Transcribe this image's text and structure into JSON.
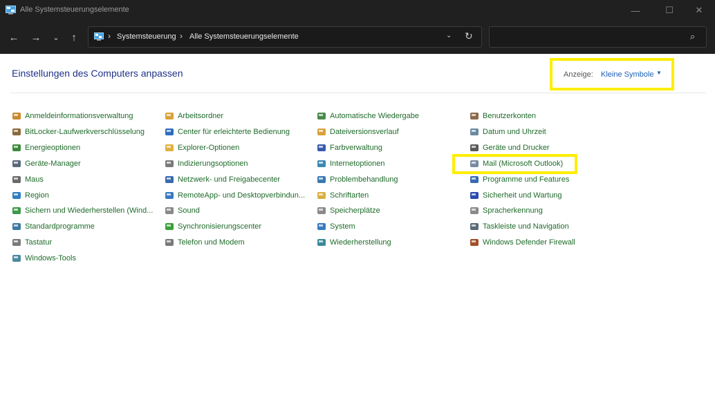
{
  "window": {
    "title": "Alle Systemsteuerungselemente",
    "minimize": "—",
    "maximize": "☐",
    "close": "✕"
  },
  "nav": {
    "back": "←",
    "forward": "→",
    "recent": "⌄",
    "up": "↑",
    "separator": "›",
    "breadcrumbs": [
      "Systemsteuerung",
      "Alle Systemsteuerungselemente"
    ],
    "dropdown": "⌄",
    "refresh": "↻",
    "search_placeholder": "",
    "search_glyph": "⌕"
  },
  "content": {
    "heading": "Einstellungen des Computers anpassen",
    "view_label": "Anzeige:",
    "view_value": "Kleine Symbole",
    "view_caret": "▼"
  },
  "items": {
    "col0": [
      {
        "label": "Anmeldeinformationsverwaltung",
        "icon": "vault-icon",
        "color": "#c98a2e"
      },
      {
        "label": "BitLocker-Laufwerkverschlüsselung",
        "icon": "bitlocker-icon",
        "color": "#8a6a3a"
      },
      {
        "label": "Energieoptionen",
        "icon": "power-icon",
        "color": "#3c8a3c"
      },
      {
        "label": "Geräte-Manager",
        "icon": "device-manager-icon",
        "color": "#5a6a7a"
      },
      {
        "label": "Maus",
        "icon": "mouse-icon",
        "color": "#6a6a6a"
      },
      {
        "label": "Region",
        "icon": "globe-icon",
        "color": "#2f7fbf"
      },
      {
        "label": "Sichern und Wiederherstellen (Wind...",
        "icon": "backup-icon",
        "color": "#3c9a4a"
      },
      {
        "label": "Standardprogramme",
        "icon": "default-programs-icon",
        "color": "#3c7aa0"
      },
      {
        "label": "Tastatur",
        "icon": "keyboard-icon",
        "color": "#7a7a7a"
      },
      {
        "label": "Windows-Tools",
        "icon": "windows-tools-icon",
        "color": "#4a8aa0"
      }
    ],
    "col1": [
      {
        "label": "Arbeitsordner",
        "icon": "work-folders-icon",
        "color": "#d9a23a"
      },
      {
        "label": "Center für erleichterte Bedienung",
        "icon": "accessibility-icon",
        "color": "#2f6fbf"
      },
      {
        "label": "Explorer-Optionen",
        "icon": "folder-options-icon",
        "color": "#e0b040"
      },
      {
        "label": "Indizierungsoptionen",
        "icon": "indexing-icon",
        "color": "#7a7a7a"
      },
      {
        "label": "Netzwerk- und Freigabecenter",
        "icon": "network-icon",
        "color": "#3a6ab0"
      },
      {
        "label": "RemoteApp- und Desktopverbindun...",
        "icon": "remoteapp-icon",
        "color": "#3a7ac0"
      },
      {
        "label": "Sound",
        "icon": "speaker-icon",
        "color": "#8a8a8a"
      },
      {
        "label": "Synchronisierungscenter",
        "icon": "sync-icon",
        "color": "#3aa03a"
      },
      {
        "label": "Telefon und Modem",
        "icon": "modem-icon",
        "color": "#7a7a7a"
      }
    ],
    "col2": [
      {
        "label": "Automatische Wiedergabe",
        "icon": "autoplay-icon",
        "color": "#4a8a4a"
      },
      {
        "label": "Dateiversionsverlauf",
        "icon": "file-history-icon",
        "color": "#d9a23a"
      },
      {
        "label": "Farbverwaltung",
        "icon": "color-management-icon",
        "color": "#3a5ab0"
      },
      {
        "label": "Internetoptionen",
        "icon": "internet-options-icon",
        "color": "#3a8ab0"
      },
      {
        "label": "Problembehandlung",
        "icon": "troubleshoot-icon",
        "color": "#3a7ab0"
      },
      {
        "label": "Schriftarten",
        "icon": "fonts-icon",
        "color": "#d9b040"
      },
      {
        "label": "Speicherplätze",
        "icon": "storage-spaces-icon",
        "color": "#8a8a8a"
      },
      {
        "label": "System",
        "icon": "system-icon",
        "color": "#3a7ac0"
      },
      {
        "label": "Wiederherstellung",
        "icon": "recovery-icon",
        "color": "#3a8a9a"
      }
    ],
    "col3": [
      {
        "label": "Benutzerkonten",
        "icon": "user-accounts-icon",
        "color": "#8a6a4a"
      },
      {
        "label": "Datum und Uhrzeit",
        "icon": "clock-icon",
        "color": "#6a8aa0"
      },
      {
        "label": "Geräte und Drucker",
        "icon": "printer-icon",
        "color": "#5a5a5a"
      },
      {
        "label": "Mail (Microsoft Outlook)",
        "icon": "mail-icon",
        "color": "#7a8aa0"
      },
      {
        "label": "Programme und Features",
        "icon": "programs-features-icon",
        "color": "#3a6ab0"
      },
      {
        "label": "Sicherheit und Wartung",
        "icon": "flag-icon",
        "color": "#2a4ab0"
      },
      {
        "label": "Spracherkennung",
        "icon": "microphone-icon",
        "color": "#8a8a8a"
      },
      {
        "label": "Taskleiste und Navigation",
        "icon": "taskbar-icon",
        "color": "#5a6a7a"
      },
      {
        "label": "Windows Defender Firewall",
        "icon": "firewall-icon",
        "color": "#a0502a"
      }
    ]
  }
}
